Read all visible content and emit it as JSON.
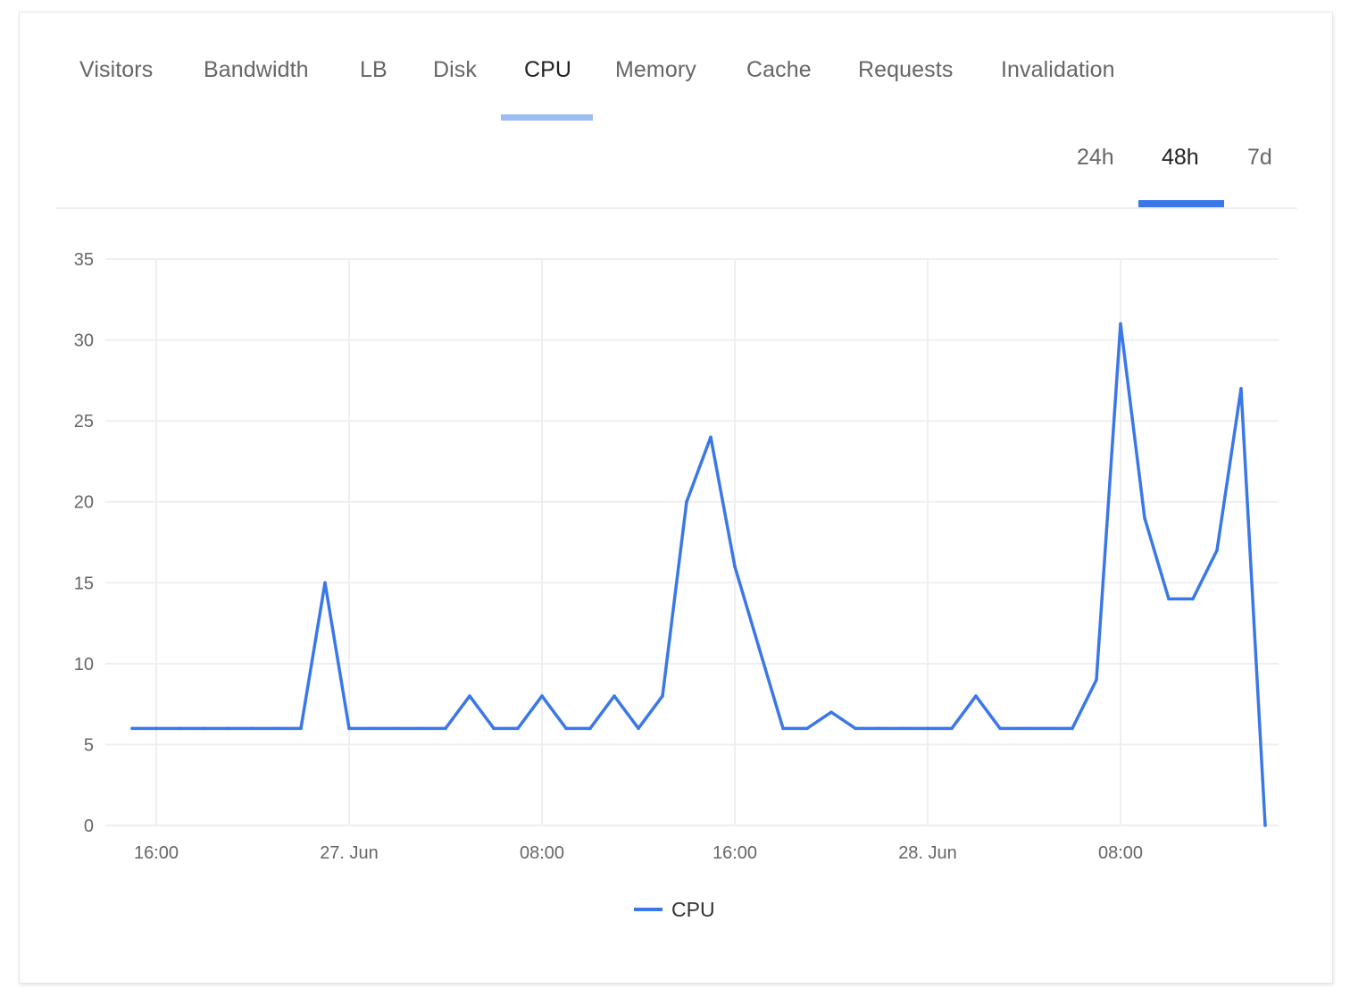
{
  "tabs": [
    {
      "label": "Visitors",
      "active": false
    },
    {
      "label": "Bandwidth",
      "active": false
    },
    {
      "label": "LB",
      "active": false
    },
    {
      "label": "Disk",
      "active": false
    },
    {
      "label": "CPU",
      "active": true
    },
    {
      "label": "Memory",
      "active": false
    },
    {
      "label": "Cache",
      "active": false
    },
    {
      "label": "Requests",
      "active": false
    },
    {
      "label": "Invalidation",
      "active": false
    }
  ],
  "time_ranges": [
    {
      "label": "24h",
      "active": false
    },
    {
      "label": "48h",
      "active": true
    },
    {
      "label": "7d",
      "active": false
    }
  ],
  "colors": {
    "series": "#3b78e7",
    "tab_indicator": "#9dbdf2",
    "range_indicator": "#3b78e7",
    "grid": "#efefef"
  },
  "chart_data": {
    "type": "line",
    "title": "",
    "xlabel": "",
    "ylabel": "",
    "ylim": [
      0,
      35
    ],
    "yticks": [
      "0",
      "5",
      "10",
      "15",
      "20",
      "25",
      "30",
      "35"
    ],
    "ytick_values": [
      0,
      5,
      10,
      15,
      20,
      25,
      30,
      35
    ],
    "x_start": "26 Jun 15:00",
    "x_step": "1 hour",
    "xticks": [
      {
        "label": "16:00",
        "index": 1
      },
      {
        "label": "27. Jun",
        "index": 9
      },
      {
        "label": "08:00",
        "index": 17
      },
      {
        "label": "16:00",
        "index": 25
      },
      {
        "label": "28. Jun",
        "index": 33
      },
      {
        "label": "08:00",
        "index": 41
      }
    ],
    "grid": true,
    "legend": "bottom-center",
    "series": [
      {
        "name": "CPU",
        "values": [
          6,
          6,
          6,
          6,
          6,
          6,
          6,
          6,
          15,
          6,
          6,
          6,
          6,
          6,
          8,
          6,
          6,
          8,
          6,
          6,
          8,
          6,
          8,
          20,
          24,
          16,
          11,
          6,
          6,
          7,
          6,
          6,
          6,
          6,
          6,
          8,
          6,
          6,
          6,
          6,
          9,
          31,
          19,
          14,
          14,
          17,
          27,
          0
        ]
      }
    ]
  }
}
